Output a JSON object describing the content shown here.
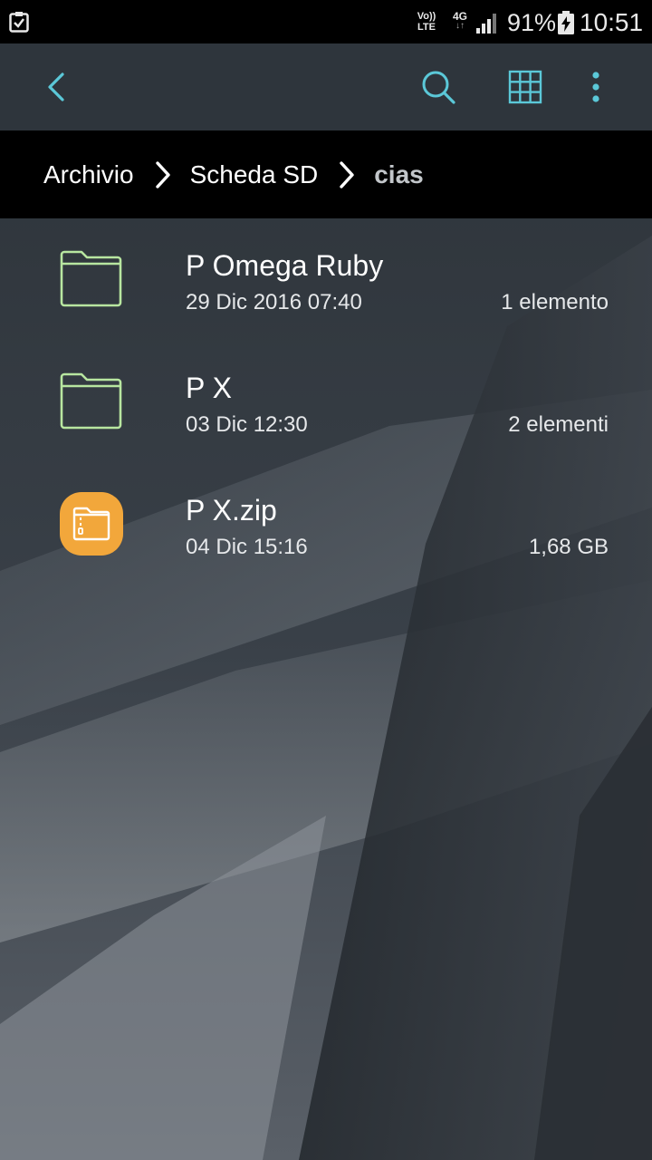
{
  "status_bar": {
    "volte_line1": "Vo))",
    "volte_line2": "LTE",
    "network": "4G",
    "network_arrows": "↓↑",
    "battery_percent": "91%",
    "battery_level": 0.91,
    "time": "10:51"
  },
  "toolbar": {
    "back_icon": "chevron-left-icon",
    "search_icon": "search-icon",
    "grid_icon": "grid-view-icon",
    "more_icon": "more-vert-icon"
  },
  "breadcrumb": {
    "items": [
      {
        "label": "Archivio"
      },
      {
        "label": "Scheda SD"
      },
      {
        "label": "cias"
      }
    ]
  },
  "files": [
    {
      "name": "P Omega Ruby",
      "date": "29 Dic 2016 07:40",
      "meta": "1 elemento",
      "type": "folder",
      "icon": "folder-icon"
    },
    {
      "name": "P X",
      "date": "03 Dic 12:30",
      "meta": "2 elementi",
      "type": "folder",
      "icon": "folder-icon"
    },
    {
      "name": "P X.zip",
      "date": "04 Dic 15:16",
      "meta": "1,68 GB",
      "type": "archive",
      "icon": "zip-archive-icon"
    }
  ],
  "colors": {
    "accent": "#5bc8d8",
    "folder_outline": "#b8e6a0",
    "zip_icon": "#f2a73b",
    "app_bar": "#2e353c",
    "breadcrumb_bar": "#000000"
  }
}
